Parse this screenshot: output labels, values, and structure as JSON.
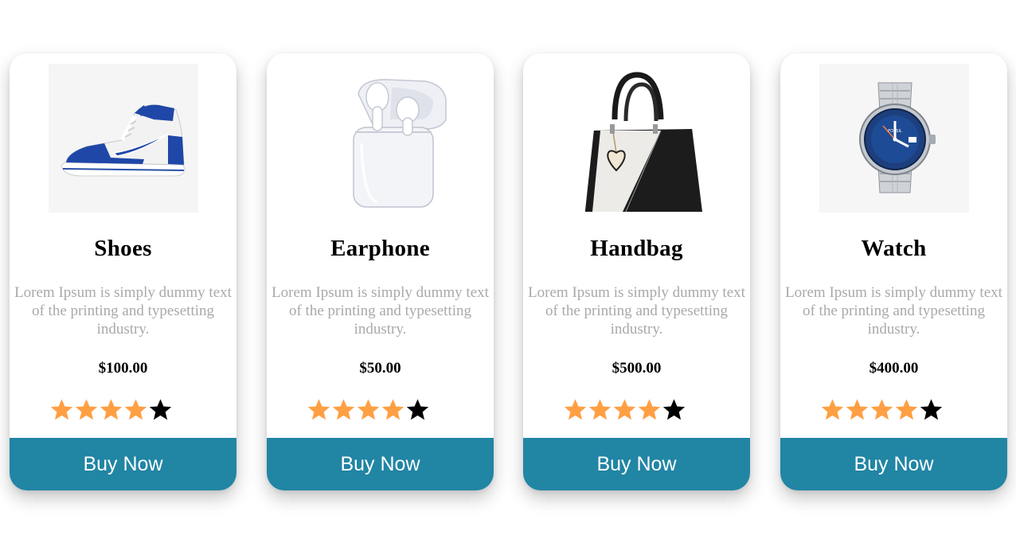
{
  "colors": {
    "accent": "#2185a4",
    "star_filled": "#ff9f43",
    "star_empty": "#000000",
    "description": "#a9a9a9"
  },
  "products": [
    {
      "icon": "sneaker-image",
      "title": "Shoes",
      "description": "Lorem Ipsum is simply dummy text of the printing and typesetting industry.",
      "price": "$100.00",
      "rating": 4,
      "rating_max": 5,
      "button_label": "Buy Now"
    },
    {
      "icon": "earphones-image",
      "title": "Earphone",
      "description": "Lorem Ipsum is simply dummy text of the printing and typesetting industry.",
      "price": "$50.00",
      "rating": 4,
      "rating_max": 5,
      "button_label": "Buy Now"
    },
    {
      "icon": "handbag-image",
      "title": "Handbag",
      "description": "Lorem Ipsum is simply dummy text of the printing and typesetting industry.",
      "price": "$500.00",
      "rating": 4,
      "rating_max": 5,
      "button_label": "Buy Now"
    },
    {
      "icon": "watch-image",
      "title": "Watch",
      "description": "Lorem Ipsum is simply dummy text of the printing and typesetting industry.",
      "price": "$400.00",
      "rating": 4,
      "rating_max": 5,
      "button_label": "Buy Now"
    }
  ]
}
